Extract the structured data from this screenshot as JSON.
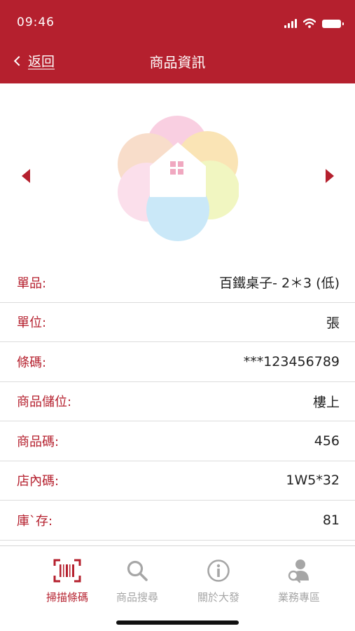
{
  "status_bar": {
    "time": "09:46"
  },
  "header": {
    "back_label": "返回",
    "title": "商品資訊"
  },
  "gallery": {
    "prev_icon": "triangle-left-icon",
    "next_icon": "triangle-right-icon",
    "image_icon": "house-flower-logo"
  },
  "product": {
    "fields": [
      {
        "label": "單品:",
        "value": "百鐵桌子- 2＊3 (低)"
      },
      {
        "label": "單位:",
        "value": "張"
      },
      {
        "label": "條碼:",
        "value": "***123456789"
      },
      {
        "label": "商品儲位:",
        "value": "樓上"
      },
      {
        "label": "商品碼:",
        "value": "456"
      },
      {
        "label": "店內碼:",
        "value": "1W5*32"
      },
      {
        "label": "庫`存:",
        "value": "81"
      }
    ]
  },
  "tabbar": {
    "tabs": [
      {
        "label": "掃描條碼",
        "icon": "barcode-scan-icon",
        "active": true
      },
      {
        "label": "商品搜尋",
        "icon": "search-icon",
        "active": false
      },
      {
        "label": "關於大發",
        "icon": "info-icon",
        "active": false
      },
      {
        "label": "業務專區",
        "icon": "user-search-icon",
        "active": false
      }
    ]
  },
  "colors": {
    "brand": "#b5202e",
    "inactive": "#a6a6a6",
    "divider": "#dcdcdc"
  }
}
